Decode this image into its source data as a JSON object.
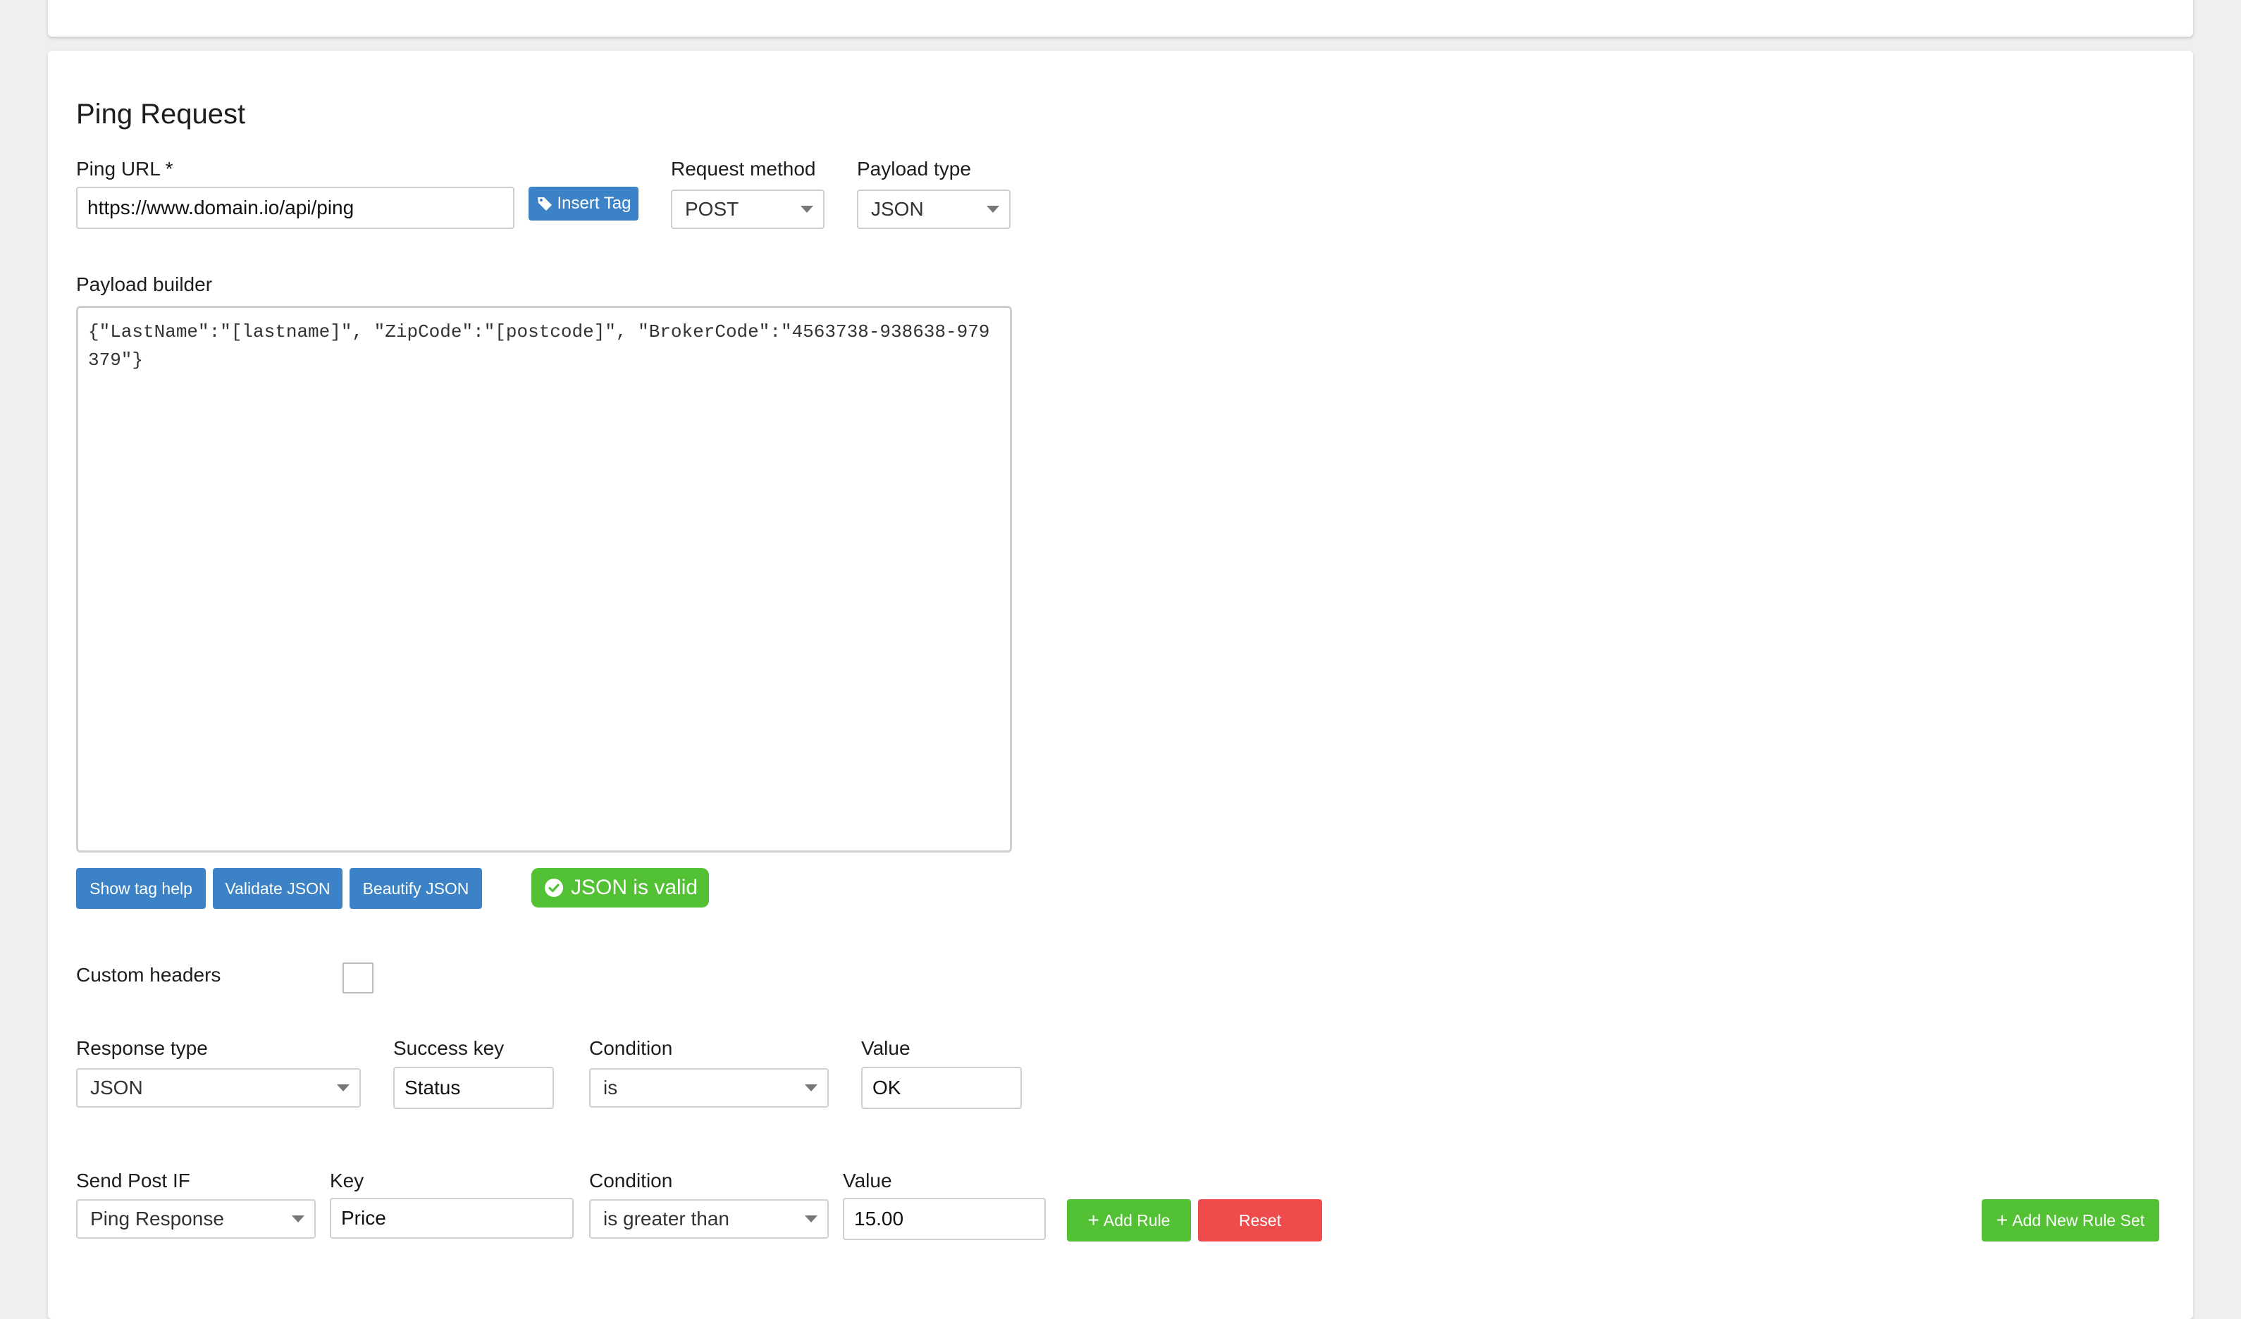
{
  "section": {
    "title": "Ping Request"
  },
  "ping_url": {
    "label": "Ping URL *",
    "value": "https://www.domain.io/api/ping",
    "insert_tag_label": "Insert Tag"
  },
  "request_method": {
    "label": "Request method",
    "selected": "POST"
  },
  "payload_type": {
    "label": "Payload type",
    "selected": "JSON"
  },
  "payload_builder": {
    "label": "Payload builder",
    "value": "{\"LastName\":\"[lastname]\", \"ZipCode\":\"[postcode]\", \"BrokerCode\":\"4563738-938638-979379\"}"
  },
  "payload_actions": {
    "show_tag_help": "Show tag help",
    "validate_json": "Validate JSON",
    "beautify_json": "Beautify JSON",
    "status": "JSON is valid"
  },
  "custom_headers": {
    "label": "Custom headers",
    "checked": false
  },
  "response": {
    "type_label": "Response type",
    "type_selected": "JSON",
    "success_key_label": "Success key",
    "success_key_value": "Status",
    "condition_label": "Condition",
    "condition_selected": "is",
    "value_label": "Value",
    "value": "OK"
  },
  "send_post": {
    "if_label": "Send Post IF",
    "if_selected": "Ping Response",
    "key_label": "Key",
    "key_value": "Price",
    "condition_label": "Condition",
    "condition_selected": "is greater than",
    "value_label": "Value",
    "value": "15.00",
    "add_rule_label": "Add Rule",
    "reset_label": "Reset",
    "add_rule_set_label": "Add New Rule Set"
  },
  "colors": {
    "primary_blue": "#3b83c6",
    "success_green": "#52c134",
    "danger_red": "#ee4c4c"
  }
}
